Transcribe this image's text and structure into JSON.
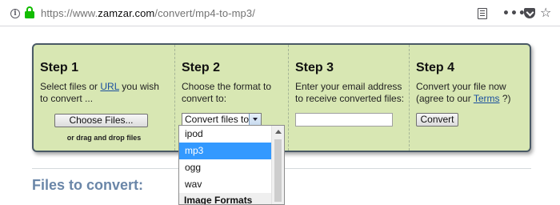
{
  "browser": {
    "url_prefix": "https://www.",
    "url_host": "zamzar.com",
    "url_path": "/convert/mp4-to-mp3/",
    "info_icon": "i",
    "more_label": "•••",
    "star_icon": "☆"
  },
  "steps": {
    "step1": {
      "title": "Step 1",
      "desc_before": "Select files or ",
      "link": "URL",
      "desc_after": " you wish to convert ...",
      "button": "Choose Files...",
      "note": "or drag and drop files"
    },
    "step2": {
      "title": "Step 2",
      "desc": "Choose the format to convert to:",
      "select_value": "Convert files to:"
    },
    "step3": {
      "title": "Step 3",
      "desc": "Enter your email address to receive converted files:",
      "email_value": ""
    },
    "step4": {
      "title": "Step 4",
      "desc_before": "Convert your file now (agree to our ",
      "link": "Terms",
      "desc_after": " ?)",
      "button": "Convert"
    }
  },
  "dropdown": {
    "options": [
      "ipod",
      "mp3",
      "ogg",
      "wav"
    ],
    "selected": "mp3",
    "group_label": "Image Formats"
  },
  "files_section": {
    "title": "Files to convert:"
  },
  "colors": {
    "panel_bg": "#d8e7b3",
    "selected_bg": "#3399ff",
    "lock": "#12bc00",
    "section_title": "#6a86a8"
  }
}
